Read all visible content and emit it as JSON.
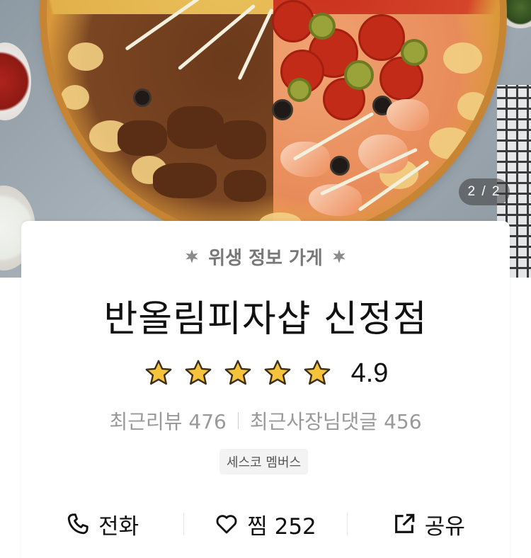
{
  "hero": {
    "page_indicator": "2 / 2",
    "current_page": 2,
    "total_pages": 2
  },
  "store": {
    "hygiene_label": "위생 정보 가게",
    "name": "반올림피자샵 신정점",
    "rating": 4.9,
    "rating_text": "4.9",
    "stars_filled": 5,
    "stars_total": 5,
    "recent_reviews": "최근리뷰 476",
    "recent_owner_replies": "최근사장님댓글 456",
    "badge": "세스코 멤버스"
  },
  "actions": {
    "call_label": "전화",
    "like_label": "찜 252",
    "share_label": "공유"
  },
  "colors": {
    "star_fill": "#F7C33A",
    "star_stroke": "#3A2E1A",
    "text_primary": "#111111",
    "text_secondary": "#999999"
  },
  "icons": [
    "laurel-left-icon",
    "laurel-right-icon",
    "star-icon",
    "phone-icon",
    "heart-icon",
    "share-icon"
  ]
}
